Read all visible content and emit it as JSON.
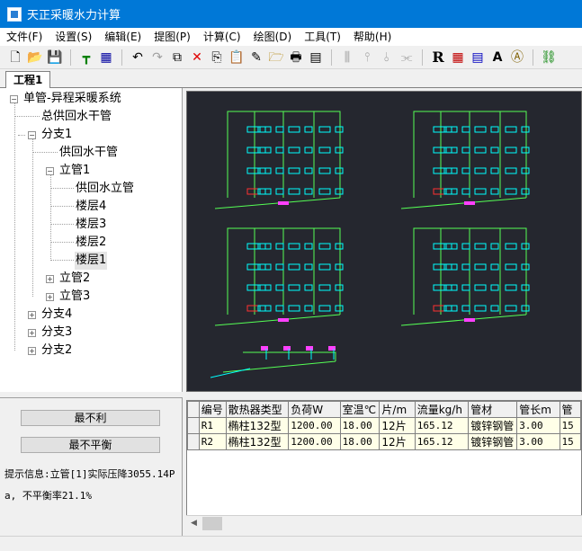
{
  "window": {
    "title": "天正采暖水力计算"
  },
  "menu": [
    "文件(F)",
    "设置(S)",
    "编辑(E)",
    "提图(P)",
    "计算(C)",
    "绘图(D)",
    "工具(T)",
    "帮助(H)"
  ],
  "tab": {
    "label": "工程1"
  },
  "tree": {
    "root": "单管-异程采暖系统",
    "main_pipe": "总供回水干管",
    "branch1": "分支1",
    "branch1_pipe": "供回水干管",
    "riser1": "立管1",
    "riser1_pipe": "供回水立管",
    "floors": [
      "楼层4",
      "楼层3",
      "楼层2",
      "楼层1"
    ],
    "riser2": "立管2",
    "riser3": "立管3",
    "branch4": "分支4",
    "branch3": "分支3",
    "branch2": "分支2"
  },
  "buttons": {
    "worst": "最不利",
    "unbalanced": "最不平衡"
  },
  "hint": {
    "text": "提示信息:立管[1]实际压降3055.14Pa, 不平衡率21.1%"
  },
  "table": {
    "columns": [
      "编号",
      "散热器类型",
      "负荷W",
      "室温℃",
      "片/m",
      "流量kg/h",
      "管材",
      "管长m",
      "管"
    ],
    "rows": [
      [
        "R1",
        "椭柱132型",
        "1200.00",
        "18.00",
        "12片",
        "165.12",
        "镀锌钢管",
        "3.00",
        "15"
      ],
      [
        "R2",
        "椭柱132型",
        "1200.00",
        "18.00",
        "12片",
        "165.12",
        "镀锌钢管",
        "3.00",
        "15"
      ]
    ]
  },
  "colors": {
    "titlebar": "#0078d7",
    "canvas": "#25272f",
    "pipe_green": "#55ff55",
    "radiator_cyan": "#00ffff",
    "label_magenta": "#ff40ff"
  }
}
